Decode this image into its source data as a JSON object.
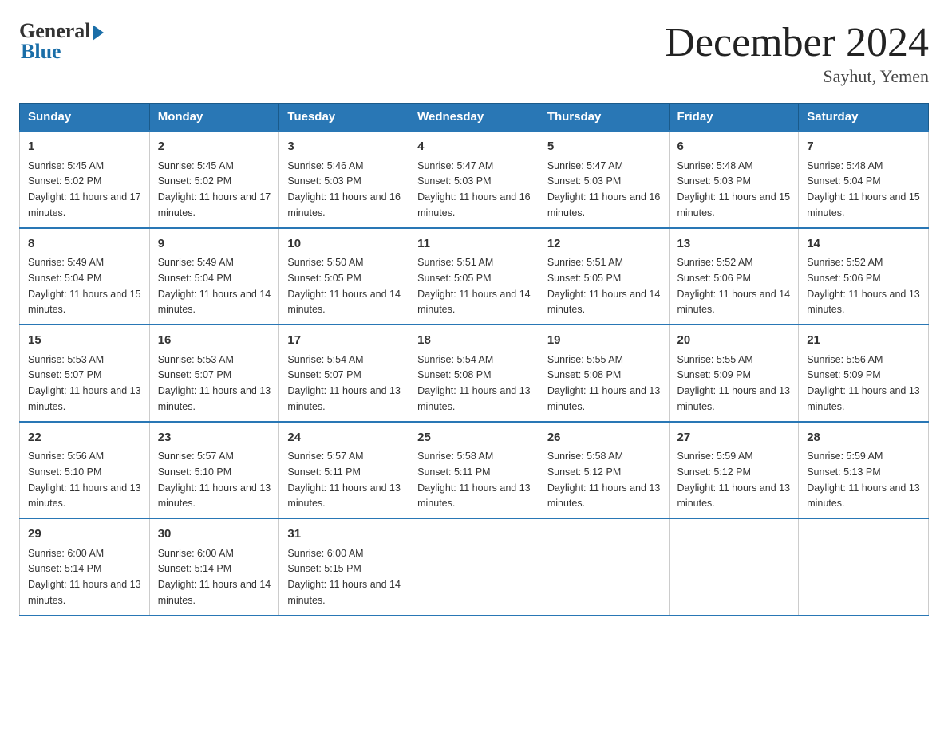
{
  "logo": {
    "general": "General",
    "blue": "Blue"
  },
  "title": {
    "month_year": "December 2024",
    "location": "Sayhut, Yemen"
  },
  "weekdays": [
    "Sunday",
    "Monday",
    "Tuesday",
    "Wednesday",
    "Thursday",
    "Friday",
    "Saturday"
  ],
  "weeks": [
    [
      {
        "day": "1",
        "sunrise": "5:45 AM",
        "sunset": "5:02 PM",
        "daylight": "11 hours and 17 minutes."
      },
      {
        "day": "2",
        "sunrise": "5:45 AM",
        "sunset": "5:02 PM",
        "daylight": "11 hours and 17 minutes."
      },
      {
        "day": "3",
        "sunrise": "5:46 AM",
        "sunset": "5:03 PM",
        "daylight": "11 hours and 16 minutes."
      },
      {
        "day": "4",
        "sunrise": "5:47 AM",
        "sunset": "5:03 PM",
        "daylight": "11 hours and 16 minutes."
      },
      {
        "day": "5",
        "sunrise": "5:47 AM",
        "sunset": "5:03 PM",
        "daylight": "11 hours and 16 minutes."
      },
      {
        "day": "6",
        "sunrise": "5:48 AM",
        "sunset": "5:03 PM",
        "daylight": "11 hours and 15 minutes."
      },
      {
        "day": "7",
        "sunrise": "5:48 AM",
        "sunset": "5:04 PM",
        "daylight": "11 hours and 15 minutes."
      }
    ],
    [
      {
        "day": "8",
        "sunrise": "5:49 AM",
        "sunset": "5:04 PM",
        "daylight": "11 hours and 15 minutes."
      },
      {
        "day": "9",
        "sunrise": "5:49 AM",
        "sunset": "5:04 PM",
        "daylight": "11 hours and 14 minutes."
      },
      {
        "day": "10",
        "sunrise": "5:50 AM",
        "sunset": "5:05 PM",
        "daylight": "11 hours and 14 minutes."
      },
      {
        "day": "11",
        "sunrise": "5:51 AM",
        "sunset": "5:05 PM",
        "daylight": "11 hours and 14 minutes."
      },
      {
        "day": "12",
        "sunrise": "5:51 AM",
        "sunset": "5:05 PM",
        "daylight": "11 hours and 14 minutes."
      },
      {
        "day": "13",
        "sunrise": "5:52 AM",
        "sunset": "5:06 PM",
        "daylight": "11 hours and 14 minutes."
      },
      {
        "day": "14",
        "sunrise": "5:52 AM",
        "sunset": "5:06 PM",
        "daylight": "11 hours and 13 minutes."
      }
    ],
    [
      {
        "day": "15",
        "sunrise": "5:53 AM",
        "sunset": "5:07 PM",
        "daylight": "11 hours and 13 minutes."
      },
      {
        "day": "16",
        "sunrise": "5:53 AM",
        "sunset": "5:07 PM",
        "daylight": "11 hours and 13 minutes."
      },
      {
        "day": "17",
        "sunrise": "5:54 AM",
        "sunset": "5:07 PM",
        "daylight": "11 hours and 13 minutes."
      },
      {
        "day": "18",
        "sunrise": "5:54 AM",
        "sunset": "5:08 PM",
        "daylight": "11 hours and 13 minutes."
      },
      {
        "day": "19",
        "sunrise": "5:55 AM",
        "sunset": "5:08 PM",
        "daylight": "11 hours and 13 minutes."
      },
      {
        "day": "20",
        "sunrise": "5:55 AM",
        "sunset": "5:09 PM",
        "daylight": "11 hours and 13 minutes."
      },
      {
        "day": "21",
        "sunrise": "5:56 AM",
        "sunset": "5:09 PM",
        "daylight": "11 hours and 13 minutes."
      }
    ],
    [
      {
        "day": "22",
        "sunrise": "5:56 AM",
        "sunset": "5:10 PM",
        "daylight": "11 hours and 13 minutes."
      },
      {
        "day": "23",
        "sunrise": "5:57 AM",
        "sunset": "5:10 PM",
        "daylight": "11 hours and 13 minutes."
      },
      {
        "day": "24",
        "sunrise": "5:57 AM",
        "sunset": "5:11 PM",
        "daylight": "11 hours and 13 minutes."
      },
      {
        "day": "25",
        "sunrise": "5:58 AM",
        "sunset": "5:11 PM",
        "daylight": "11 hours and 13 minutes."
      },
      {
        "day": "26",
        "sunrise": "5:58 AM",
        "sunset": "5:12 PM",
        "daylight": "11 hours and 13 minutes."
      },
      {
        "day": "27",
        "sunrise": "5:59 AM",
        "sunset": "5:12 PM",
        "daylight": "11 hours and 13 minutes."
      },
      {
        "day": "28",
        "sunrise": "5:59 AM",
        "sunset": "5:13 PM",
        "daylight": "11 hours and 13 minutes."
      }
    ],
    [
      {
        "day": "29",
        "sunrise": "6:00 AM",
        "sunset": "5:14 PM",
        "daylight": "11 hours and 13 minutes."
      },
      {
        "day": "30",
        "sunrise": "6:00 AM",
        "sunset": "5:14 PM",
        "daylight": "11 hours and 14 minutes."
      },
      {
        "day": "31",
        "sunrise": "6:00 AM",
        "sunset": "5:15 PM",
        "daylight": "11 hours and 14 minutes."
      },
      null,
      null,
      null,
      null
    ]
  ]
}
